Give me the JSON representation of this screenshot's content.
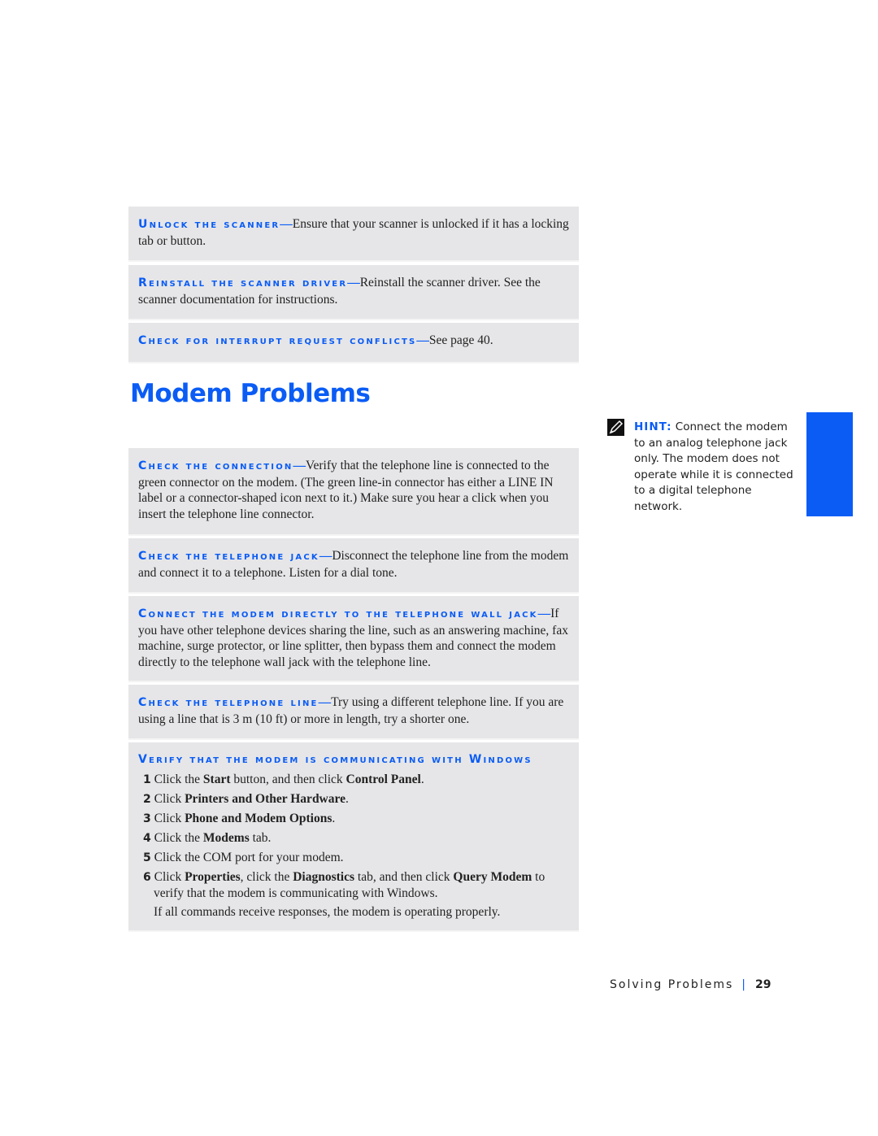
{
  "scanner_items": [
    {
      "heading": "Unlock the scanner",
      "body": "Ensure that your scanner is unlocked if it has a locking tab or button."
    },
    {
      "heading": "Reinstall the scanner driver",
      "body": "Reinstall the scanner driver. See the scanner documentation for instructions."
    },
    {
      "heading": "Check for interrupt request conflicts",
      "body": "See page 40."
    }
  ],
  "section_title": "Modem Problems",
  "modem_items": [
    {
      "heading": "Check the connection",
      "body": "Verify that the telephone line is connected to the green connector on the modem. (The green line-in connector has either a LINE IN label or a connector-shaped icon next to it.) Make sure you hear a click when you insert the telephone line connector."
    },
    {
      "heading": "Check the telephone jack",
      "body": "Disconnect the telephone line from the modem and connect it to a telephone. Listen for a dial tone."
    },
    {
      "heading": "Connect the modem directly to the telephone wall jack",
      "body": "If you have other telephone devices sharing the line, such as an answering machine, fax machine, surge protector, or line splitter, then bypass them and connect the modem directly to the telephone wall jack with the telephone line."
    },
    {
      "heading": "Check the telephone line",
      "body": "Try using a different telephone line. If you are using a line that is 3 m (10 ft) or more in length, try a shorter one."
    }
  ],
  "verify": {
    "heading": "Verify that the modem is communicating with Windows",
    "steps": [
      {
        "num": "1",
        "parts": [
          [
            "Click the ",
            0
          ],
          [
            "Start",
            1
          ],
          [
            " button, and then click ",
            0
          ],
          [
            "Control Panel",
            1
          ],
          [
            ".",
            0
          ]
        ]
      },
      {
        "num": "2",
        "parts": [
          [
            "Click ",
            0
          ],
          [
            "Printers and Other Hardware",
            1
          ],
          [
            ".",
            0
          ]
        ]
      },
      {
        "num": "3",
        "parts": [
          [
            "Click ",
            0
          ],
          [
            "Phone and Modem Options",
            1
          ],
          [
            ".",
            0
          ]
        ]
      },
      {
        "num": "4",
        "parts": [
          [
            "Click the ",
            0
          ],
          [
            "Modems",
            1
          ],
          [
            " tab.",
            0
          ]
        ]
      },
      {
        "num": "5",
        "parts": [
          [
            "Click the COM port for your modem.",
            0
          ]
        ]
      },
      {
        "num": "6",
        "parts": [
          [
            "Click ",
            0
          ],
          [
            "Properties",
            1
          ],
          [
            ", click the ",
            0
          ],
          [
            "Diagnostics",
            1
          ],
          [
            " tab, and then click ",
            0
          ],
          [
            "Query Modem",
            1
          ],
          [
            " to verify that the modem is communicating with Windows.",
            0
          ]
        ]
      }
    ],
    "note": "If all commands receive responses, the modem is operating properly."
  },
  "hint": {
    "label": "HINT:",
    "text": " Connect the modem to an analog telephone jack only. The modem does not operate while it is connected to a digital telephone network.",
    "icon": "pencil-note-icon"
  },
  "footer": {
    "section": "Solving Problems",
    "separator": "|",
    "page": "29"
  },
  "colors": {
    "accent": "#0a5cf5",
    "box": "#e6e6e8"
  }
}
